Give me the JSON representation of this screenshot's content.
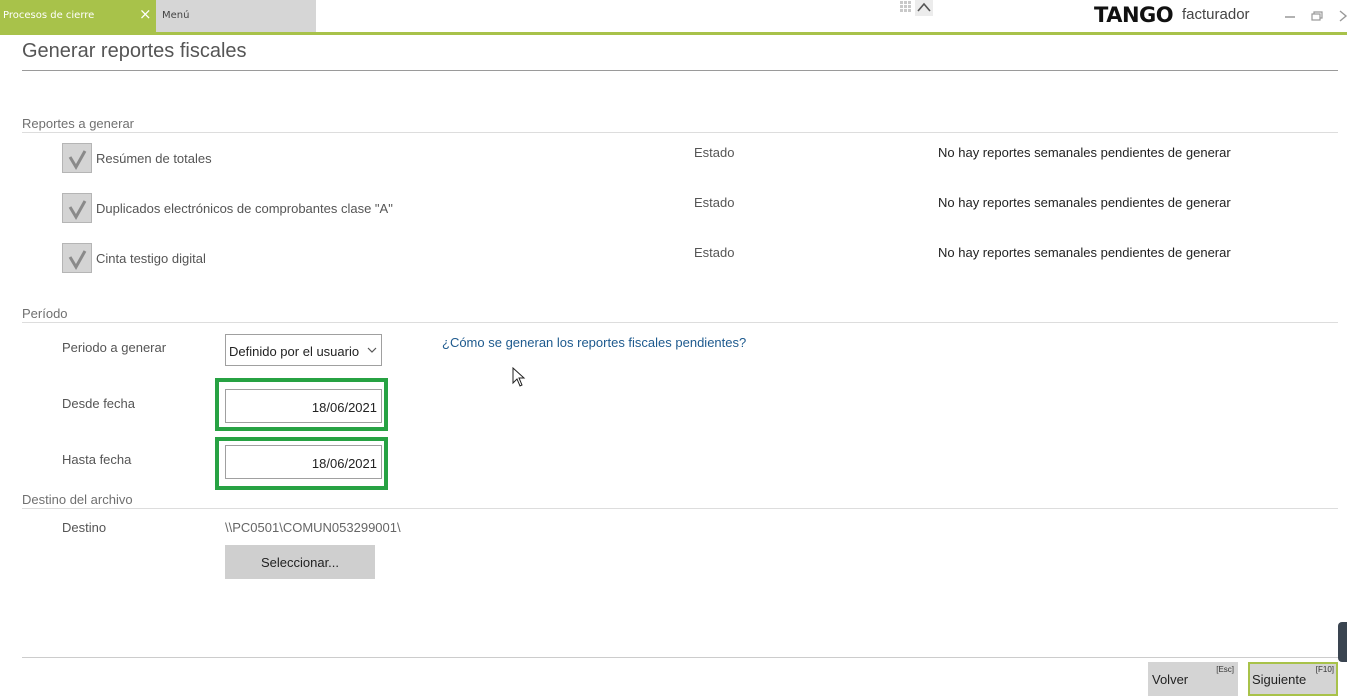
{
  "tabs": {
    "active": "Procesos de cierre",
    "close": "×",
    "menu": "Menú"
  },
  "brand": {
    "logo": "TANGO",
    "product": "facturador"
  },
  "page": {
    "title": "Generar reportes fiscales"
  },
  "reports": {
    "section": "Reportes a generar",
    "items": [
      {
        "label": "Resúmen de totales",
        "checked": true,
        "status_label": "Estado",
        "status": "No hay reportes semanales pendientes de generar"
      },
      {
        "label": "Duplicados electrónicos de comprobantes clase \"A\"",
        "checked": true,
        "status_label": "Estado",
        "status": "No hay reportes semanales pendientes de generar"
      },
      {
        "label": "Cinta testigo digital",
        "checked": true,
        "status_label": "Estado",
        "status": "No hay reportes semanales pendientes de generar"
      }
    ]
  },
  "period": {
    "section": "Período",
    "period_label": "Periodo a generar",
    "period_value": "Definido por el usuario",
    "help_link": "¿Cómo se generan los reportes fiscales pendientes?",
    "from_label": "Desde fecha",
    "from_value": "18/06/2021",
    "to_label": "Hasta fecha",
    "to_value": "18/06/2021"
  },
  "destination": {
    "section": "Destino del archivo",
    "label": "Destino",
    "path": "\\\\PC0501\\COMUN053299001\\",
    "select_button": "Seleccionar..."
  },
  "footer": {
    "back_label": "Volver",
    "back_key": "[Esc]",
    "next_label": "Siguiente",
    "next_key": "[F10]"
  },
  "colors": {
    "accent": "#a8c24a",
    "highlight": "#27a243",
    "link": "#1e5a8e"
  }
}
